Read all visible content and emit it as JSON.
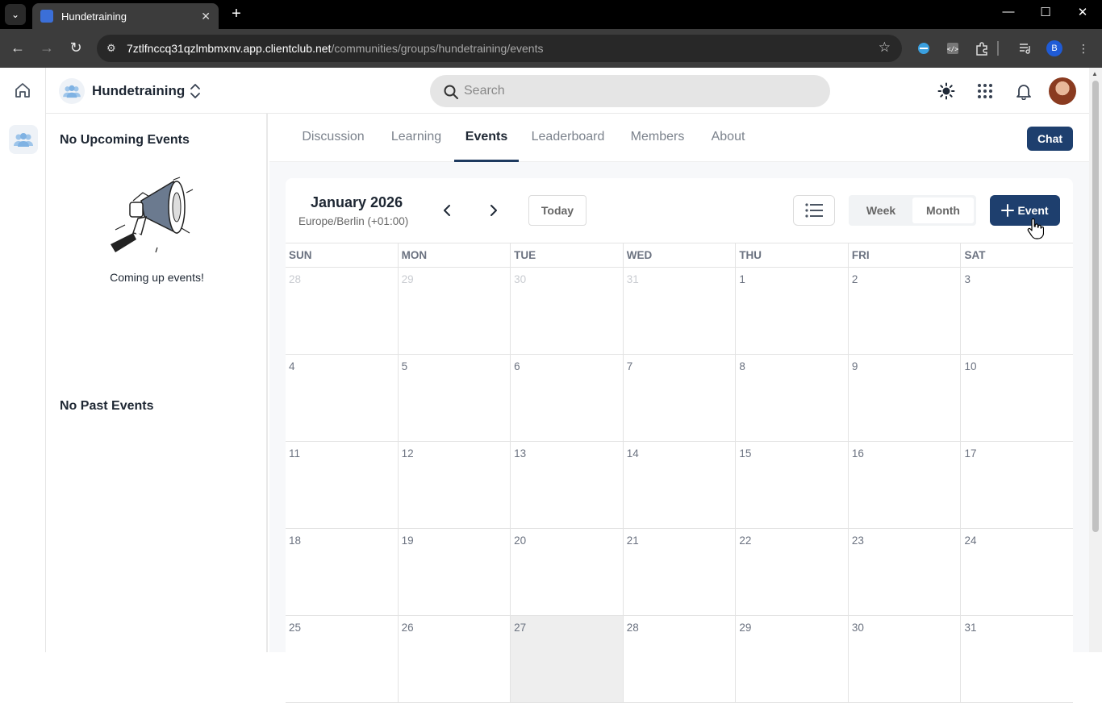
{
  "browser": {
    "tab_title": "Hundetraining",
    "url_host": "7ztlfnccq31qzlmbmxnv.app.clientclub.net",
    "url_path": "/communities/groups/hundetraining/events",
    "profile_initial": "B"
  },
  "header": {
    "group_name": "Hundetraining",
    "search_placeholder": "Search"
  },
  "sidepanel": {
    "upcoming_heading": "No Upcoming Events",
    "upcoming_caption": "Coming up events!",
    "past_heading": "No Past Events"
  },
  "tabs": [
    "Discussion",
    "Learning",
    "Events",
    "Leaderboard",
    "Members",
    "About"
  ],
  "active_tab": "Events",
  "chat_label": "Chat",
  "calendar": {
    "month_title": "January 2026",
    "timezone": "Europe/Berlin (+01:00)",
    "today_label": "Today",
    "view_week": "Week",
    "view_month": "Month",
    "active_view": "Month",
    "event_label": "Event",
    "weekdays": [
      "SUN",
      "MON",
      "TUE",
      "WED",
      "THU",
      "FRI",
      "SAT"
    ],
    "weeks": [
      [
        "28",
        "29",
        "30",
        "31",
        "1",
        "2",
        "3"
      ],
      [
        "4",
        "5",
        "6",
        "7",
        "8",
        "9",
        "10"
      ],
      [
        "11",
        "12",
        "13",
        "14",
        "15",
        "16",
        "17"
      ],
      [
        "18",
        "19",
        "20",
        "21",
        "22",
        "23",
        "24"
      ],
      [
        "25",
        "26",
        "27",
        "28",
        "29",
        "30",
        "31"
      ]
    ],
    "today_date": "27"
  },
  "colors": {
    "primary": "#1e3f6e",
    "today_cell": "#eeeeee"
  }
}
